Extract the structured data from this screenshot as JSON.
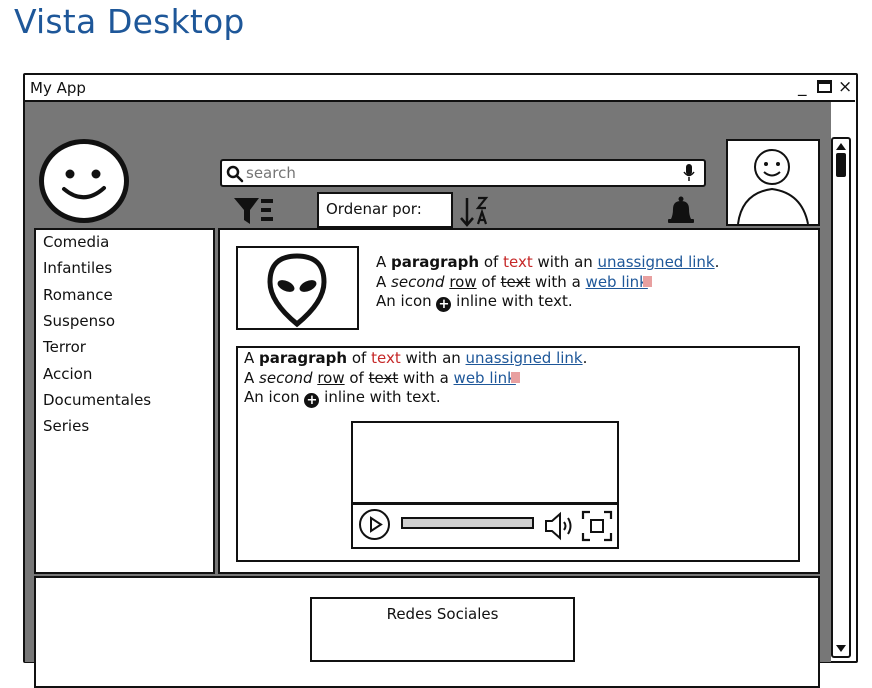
{
  "page": {
    "title": "Vista Desktop"
  },
  "window": {
    "title": "My App",
    "controls": {
      "minimize": "_",
      "close": "×"
    }
  },
  "search": {
    "placeholder": "search"
  },
  "sort": {
    "label": "Ordenar por:"
  },
  "sidebar": {
    "items": [
      {
        "label": "Comedia"
      },
      {
        "label": "Infantiles"
      },
      {
        "label": "Romance"
      },
      {
        "label": "Suspenso"
      },
      {
        "label": "Terror"
      },
      {
        "label": "Accion"
      },
      {
        "label": "Documentales"
      },
      {
        "label": "Series"
      }
    ]
  },
  "content": {
    "para_top": {
      "line1": {
        "a": "A ",
        "bold": "paragraph",
        "of": " of ",
        "red": "text",
        "with": " with an ",
        "link": "unassigned link",
        "end": "."
      },
      "line2": {
        "a": "A ",
        "second": "second",
        "sp": " ",
        "row": "row",
        "of": " of ",
        "strike": "text",
        "with": " with a ",
        "link": "web link"
      },
      "line3": {
        "a": "An icon ",
        "b": " inline with text."
      }
    },
    "para_inner": {
      "line1": {
        "a": "A ",
        "bold": "paragraph",
        "of": " of ",
        "red": "text",
        "with": " with an ",
        "link": "unassigned link",
        "end": "."
      },
      "line2": {
        "a": "A ",
        "second": "second",
        "sp": " ",
        "row": "row",
        "of": " of ",
        "strike": "text",
        "with": " with a ",
        "link": "web link"
      },
      "line3": {
        "a": "An icon ",
        "b": " inline with text."
      }
    }
  },
  "footer": {
    "social": "Redes Sociales"
  },
  "icons": [
    "logo-smiley-icon",
    "search-icon",
    "microphone-icon",
    "user-avatar-icon",
    "filter-icon",
    "sort-z-a-icon",
    "bell-icon",
    "alien-icon",
    "plus-circle-icon",
    "play-icon",
    "volume-icon",
    "fullscreen-icon",
    "scroll-up-icon",
    "scroll-down-icon"
  ],
  "colors": {
    "title": "#1e5799",
    "link": "#1e5799",
    "red_text": "#c62828",
    "chrome_gray": "#777777"
  }
}
